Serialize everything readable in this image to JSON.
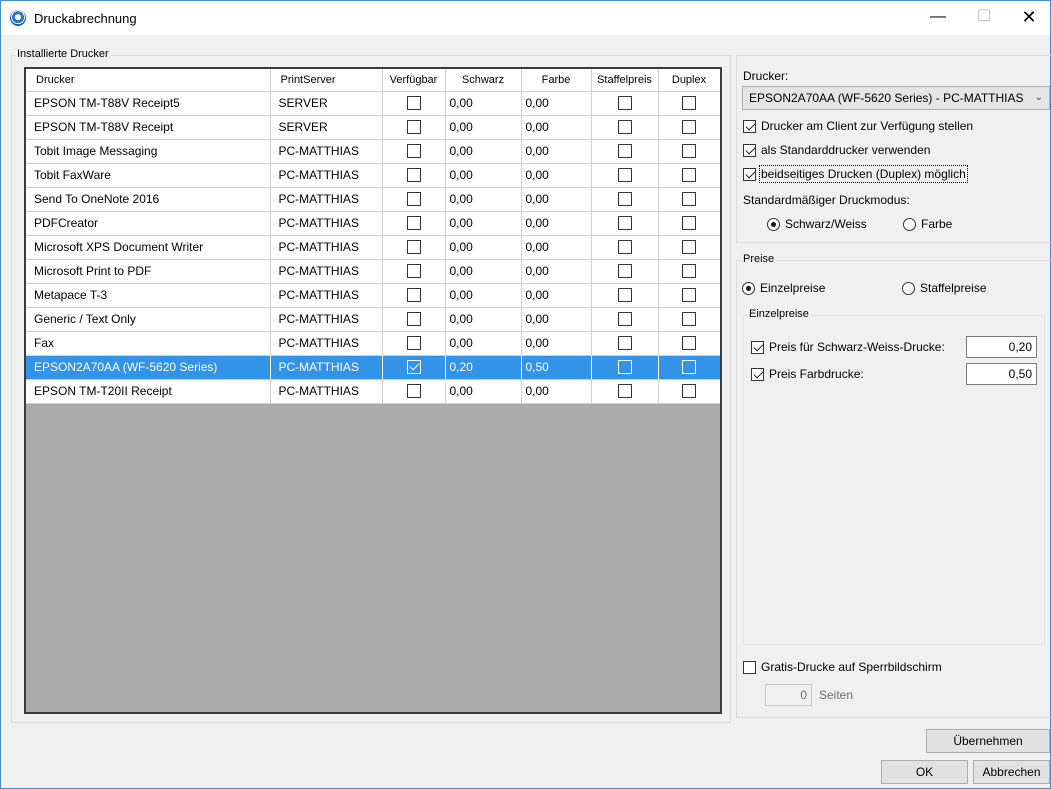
{
  "window": {
    "title": "Druckabrechnung",
    "min_glyph": "—",
    "max_glyph": "☐",
    "close_glyph": "✕"
  },
  "installed": {
    "group_label": "Installierte Drucker",
    "columns": [
      "Drucker",
      "PrintServer",
      "Verfügbar",
      "Schwarz",
      "Farbe",
      "Staffelpreis",
      "Duplex"
    ],
    "rows": [
      {
        "name": "EPSON TM-T88V Receipt5",
        "server": "SERVER",
        "available": false,
        "black": "0,00",
        "color": "0,00",
        "tiered": false,
        "duplex": false,
        "selected": false
      },
      {
        "name": "EPSON TM-T88V Receipt",
        "server": "SERVER",
        "available": false,
        "black": "0,00",
        "color": "0,00",
        "tiered": false,
        "duplex": false,
        "selected": false
      },
      {
        "name": "Tobit Image Messaging",
        "server": "PC-MATTHIAS",
        "available": false,
        "black": "0,00",
        "color": "0,00",
        "tiered": false,
        "duplex": false,
        "selected": false
      },
      {
        "name": "Tobit FaxWare",
        "server": "PC-MATTHIAS",
        "available": false,
        "black": "0,00",
        "color": "0,00",
        "tiered": false,
        "duplex": false,
        "selected": false
      },
      {
        "name": "Send To OneNote 2016",
        "server": "PC-MATTHIAS",
        "available": false,
        "black": "0,00",
        "color": "0,00",
        "tiered": false,
        "duplex": false,
        "selected": false
      },
      {
        "name": "PDFCreator",
        "server": "PC-MATTHIAS",
        "available": false,
        "black": "0,00",
        "color": "0,00",
        "tiered": false,
        "duplex": false,
        "selected": false
      },
      {
        "name": "Microsoft XPS Document Writer",
        "server": "PC-MATTHIAS",
        "available": false,
        "black": "0,00",
        "color": "0,00",
        "tiered": false,
        "duplex": false,
        "selected": false
      },
      {
        "name": "Microsoft Print to PDF",
        "server": "PC-MATTHIAS",
        "available": false,
        "black": "0,00",
        "color": "0,00",
        "tiered": false,
        "duplex": false,
        "selected": false
      },
      {
        "name": "Metapace T-3",
        "server": "PC-MATTHIAS",
        "available": false,
        "black": "0,00",
        "color": "0,00",
        "tiered": false,
        "duplex": false,
        "selected": false
      },
      {
        "name": "Generic / Text Only",
        "server": "PC-MATTHIAS",
        "available": false,
        "black": "0,00",
        "color": "0,00",
        "tiered": false,
        "duplex": false,
        "selected": false
      },
      {
        "name": "Fax",
        "server": "PC-MATTHIAS",
        "available": false,
        "black": "0,00",
        "color": "0,00",
        "tiered": false,
        "duplex": false,
        "selected": false
      },
      {
        "name": "EPSON2A70AA (WF-5620 Series)",
        "server": "PC-MATTHIAS",
        "available": true,
        "black": "0,20",
        "color": "0,50",
        "tiered": false,
        "duplex": false,
        "selected": true
      },
      {
        "name": "EPSON TM-T20II Receipt",
        "server": "PC-MATTHIAS",
        "available": false,
        "black": "0,00",
        "color": "0,00",
        "tiered": false,
        "duplex": false,
        "selected": false
      }
    ]
  },
  "printer_panel": {
    "printer_label": "Drucker:",
    "printer_selected": "EPSON2A70AA (WF-5620 Series) - PC-MATTHIAS",
    "chk_client": {
      "label": "Drucker am Client zur Verfügung stellen",
      "checked": true
    },
    "chk_default": {
      "label": "als Standarddrucker verwenden",
      "checked": true
    },
    "chk_duplex": {
      "label": "beidseitiges Drucken (Duplex) möglich",
      "checked": true
    },
    "mode_label": "Standardmäßiger Druckmodus:",
    "radio_bw": {
      "label": "Schwarz/Weiss",
      "checked": true
    },
    "radio_color": {
      "label": "Farbe",
      "checked": false
    }
  },
  "prices": {
    "group_label": "Preise",
    "radio_single": {
      "label": "Einzelpreise",
      "checked": true
    },
    "radio_tiered": {
      "label": "Staffelpreise",
      "checked": false
    },
    "single_group_label": "Einzelpreise",
    "chk_bw": {
      "label": "Preis für Schwarz-Weiss-Drucke:",
      "checked": true
    },
    "bw_value": "0,20",
    "chk_color": {
      "label": "Preis Farbdrucke:",
      "checked": true
    },
    "color_value": "0,50"
  },
  "free_prints": {
    "label": "Gratis-Drucke auf Sperrbildschirm",
    "checked": false,
    "pages_value": "0",
    "pages_label": "Seiten"
  },
  "buttons": {
    "apply": "Übernehmen",
    "ok": "OK",
    "cancel": "Abbrechen"
  }
}
